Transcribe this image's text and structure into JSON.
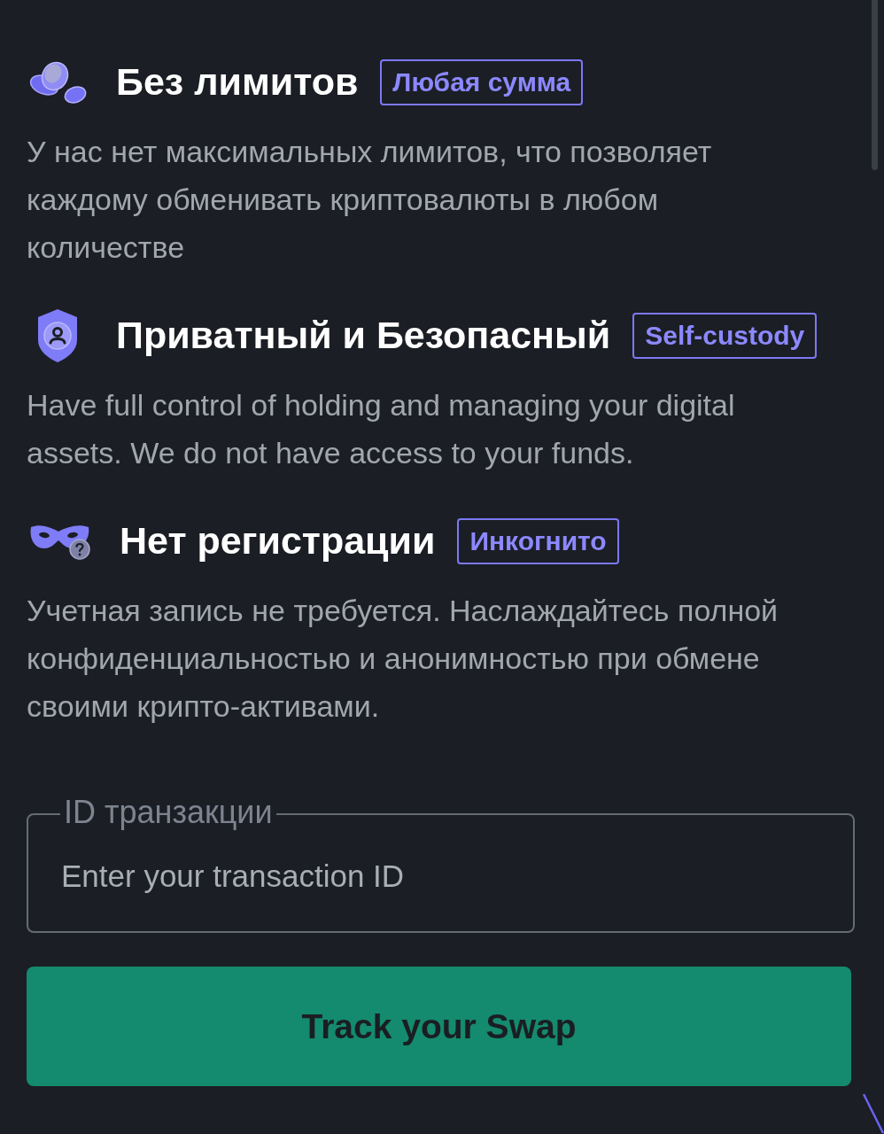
{
  "features": [
    {
      "kind": "coins",
      "title": "Без лимитов",
      "tag": "Любая сумма",
      "description": "У нас нет максимальных лимитов, что позволяет каждому обменивать криптовалюты в любом количестве"
    },
    {
      "kind": "shield",
      "title": "Приватный и Безопасный",
      "tag": "Self-custody",
      "description": "Have full control of holding and managing your digital assets. We do not have access to your funds."
    },
    {
      "kind": "mask",
      "title": "Нет регистрации",
      "tag": "Инкогнито",
      "description": "Учетная запись не требуется. Наслаждайтесь полной конфиденциальностью и анонимностью при обмене своими крипто-активами."
    }
  ],
  "transaction_field": {
    "label": "ID транзакции",
    "placeholder": "Enter your transaction ID"
  },
  "track_button": {
    "label": "Track your Swap"
  }
}
